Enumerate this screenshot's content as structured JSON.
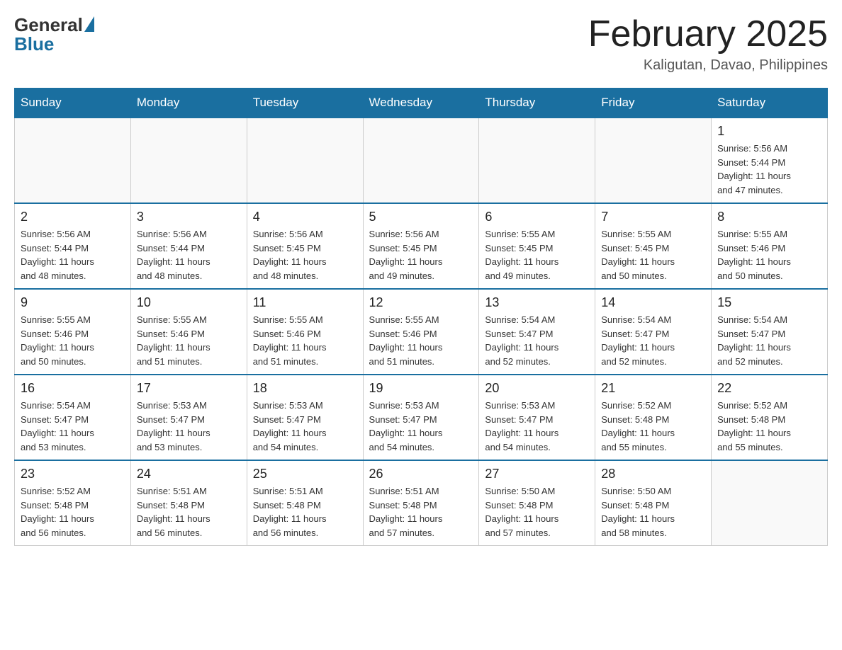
{
  "header": {
    "logo_general": "General",
    "logo_blue": "Blue",
    "month_title": "February 2025",
    "location": "Kaligutan, Davao, Philippines"
  },
  "days_of_week": [
    "Sunday",
    "Monday",
    "Tuesday",
    "Wednesday",
    "Thursday",
    "Friday",
    "Saturday"
  ],
  "weeks": [
    [
      {
        "day": "",
        "info": ""
      },
      {
        "day": "",
        "info": ""
      },
      {
        "day": "",
        "info": ""
      },
      {
        "day": "",
        "info": ""
      },
      {
        "day": "",
        "info": ""
      },
      {
        "day": "",
        "info": ""
      },
      {
        "day": "1",
        "info": "Sunrise: 5:56 AM\nSunset: 5:44 PM\nDaylight: 11 hours\nand 47 minutes."
      }
    ],
    [
      {
        "day": "2",
        "info": "Sunrise: 5:56 AM\nSunset: 5:44 PM\nDaylight: 11 hours\nand 48 minutes."
      },
      {
        "day": "3",
        "info": "Sunrise: 5:56 AM\nSunset: 5:44 PM\nDaylight: 11 hours\nand 48 minutes."
      },
      {
        "day": "4",
        "info": "Sunrise: 5:56 AM\nSunset: 5:45 PM\nDaylight: 11 hours\nand 48 minutes."
      },
      {
        "day": "5",
        "info": "Sunrise: 5:56 AM\nSunset: 5:45 PM\nDaylight: 11 hours\nand 49 minutes."
      },
      {
        "day": "6",
        "info": "Sunrise: 5:55 AM\nSunset: 5:45 PM\nDaylight: 11 hours\nand 49 minutes."
      },
      {
        "day": "7",
        "info": "Sunrise: 5:55 AM\nSunset: 5:45 PM\nDaylight: 11 hours\nand 50 minutes."
      },
      {
        "day": "8",
        "info": "Sunrise: 5:55 AM\nSunset: 5:46 PM\nDaylight: 11 hours\nand 50 minutes."
      }
    ],
    [
      {
        "day": "9",
        "info": "Sunrise: 5:55 AM\nSunset: 5:46 PM\nDaylight: 11 hours\nand 50 minutes."
      },
      {
        "day": "10",
        "info": "Sunrise: 5:55 AM\nSunset: 5:46 PM\nDaylight: 11 hours\nand 51 minutes."
      },
      {
        "day": "11",
        "info": "Sunrise: 5:55 AM\nSunset: 5:46 PM\nDaylight: 11 hours\nand 51 minutes."
      },
      {
        "day": "12",
        "info": "Sunrise: 5:55 AM\nSunset: 5:46 PM\nDaylight: 11 hours\nand 51 minutes."
      },
      {
        "day": "13",
        "info": "Sunrise: 5:54 AM\nSunset: 5:47 PM\nDaylight: 11 hours\nand 52 minutes."
      },
      {
        "day": "14",
        "info": "Sunrise: 5:54 AM\nSunset: 5:47 PM\nDaylight: 11 hours\nand 52 minutes."
      },
      {
        "day": "15",
        "info": "Sunrise: 5:54 AM\nSunset: 5:47 PM\nDaylight: 11 hours\nand 52 minutes."
      }
    ],
    [
      {
        "day": "16",
        "info": "Sunrise: 5:54 AM\nSunset: 5:47 PM\nDaylight: 11 hours\nand 53 minutes."
      },
      {
        "day": "17",
        "info": "Sunrise: 5:53 AM\nSunset: 5:47 PM\nDaylight: 11 hours\nand 53 minutes."
      },
      {
        "day": "18",
        "info": "Sunrise: 5:53 AM\nSunset: 5:47 PM\nDaylight: 11 hours\nand 54 minutes."
      },
      {
        "day": "19",
        "info": "Sunrise: 5:53 AM\nSunset: 5:47 PM\nDaylight: 11 hours\nand 54 minutes."
      },
      {
        "day": "20",
        "info": "Sunrise: 5:53 AM\nSunset: 5:47 PM\nDaylight: 11 hours\nand 54 minutes."
      },
      {
        "day": "21",
        "info": "Sunrise: 5:52 AM\nSunset: 5:48 PM\nDaylight: 11 hours\nand 55 minutes."
      },
      {
        "day": "22",
        "info": "Sunrise: 5:52 AM\nSunset: 5:48 PM\nDaylight: 11 hours\nand 55 minutes."
      }
    ],
    [
      {
        "day": "23",
        "info": "Sunrise: 5:52 AM\nSunset: 5:48 PM\nDaylight: 11 hours\nand 56 minutes."
      },
      {
        "day": "24",
        "info": "Sunrise: 5:51 AM\nSunset: 5:48 PM\nDaylight: 11 hours\nand 56 minutes."
      },
      {
        "day": "25",
        "info": "Sunrise: 5:51 AM\nSunset: 5:48 PM\nDaylight: 11 hours\nand 56 minutes."
      },
      {
        "day": "26",
        "info": "Sunrise: 5:51 AM\nSunset: 5:48 PM\nDaylight: 11 hours\nand 57 minutes."
      },
      {
        "day": "27",
        "info": "Sunrise: 5:50 AM\nSunset: 5:48 PM\nDaylight: 11 hours\nand 57 minutes."
      },
      {
        "day": "28",
        "info": "Sunrise: 5:50 AM\nSunset: 5:48 PM\nDaylight: 11 hours\nand 58 minutes."
      },
      {
        "day": "",
        "info": ""
      }
    ]
  ]
}
